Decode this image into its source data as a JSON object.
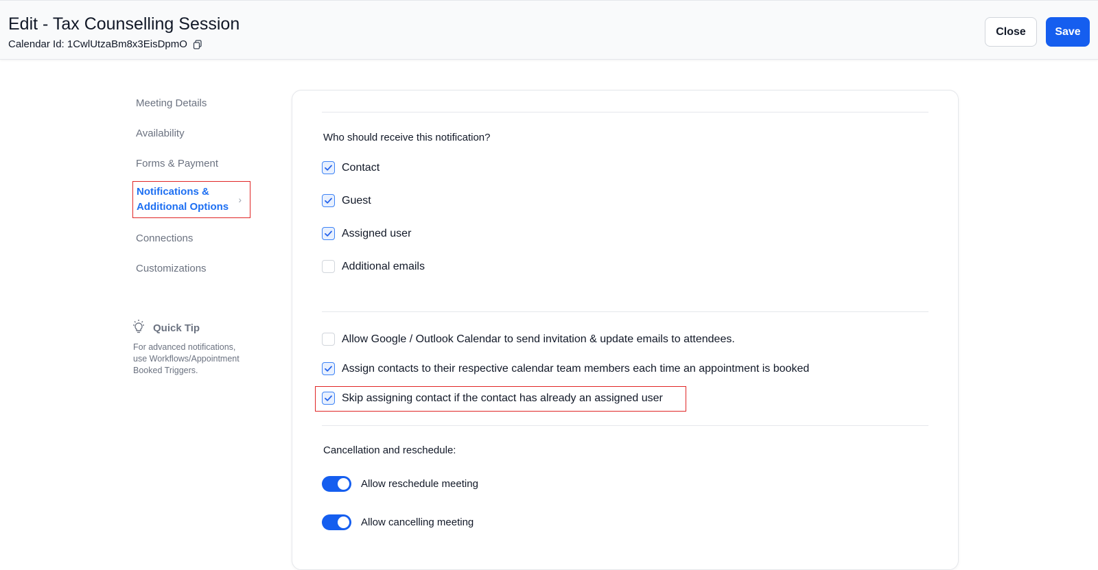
{
  "header": {
    "title": "Edit - Tax Counselling Session",
    "calendar_id_label": "Calendar Id: 1CwlUtzaBm8x3EisDpmO",
    "close_label": "Close",
    "save_label": "Save",
    "accent_color": "#155eef"
  },
  "sidebar": {
    "items": [
      {
        "label": "Meeting Details"
      },
      {
        "label": "Availability"
      },
      {
        "label": "Forms & Payment"
      },
      {
        "label": "Notifications & Additional Options",
        "line1": "Notifications &",
        "line2": "Additional Options",
        "active": true
      },
      {
        "label": "Connections"
      },
      {
        "label": "Customizations"
      }
    ],
    "tip": {
      "title": "Quick Tip",
      "text": "For advanced notifications, use Workflows/Appointment Booked Triggers.",
      "icon": "lightbulb-icon"
    }
  },
  "notifications": {
    "question": "Who should receive this notification?",
    "recipients": [
      {
        "label": "Contact",
        "checked": true
      },
      {
        "label": "Guest",
        "checked": true
      },
      {
        "label": "Assigned user",
        "checked": true
      },
      {
        "label": "Additional emails",
        "checked": false
      }
    ]
  },
  "options": [
    {
      "label": "Allow Google / Outlook Calendar to send invitation & update emails to attendees.",
      "checked": false
    },
    {
      "label": "Assign contacts to their respective calendar team members each time an appointment is booked",
      "checked": true
    },
    {
      "label": "Skip assigning contact if the contact has already an assigned user",
      "checked": true
    }
  ],
  "cancellation": {
    "title": "Cancellation and reschedule:",
    "toggles": [
      {
        "label": "Allow reschedule meeting",
        "on": true
      },
      {
        "label": "Allow cancelling meeting",
        "on": true
      }
    ]
  }
}
